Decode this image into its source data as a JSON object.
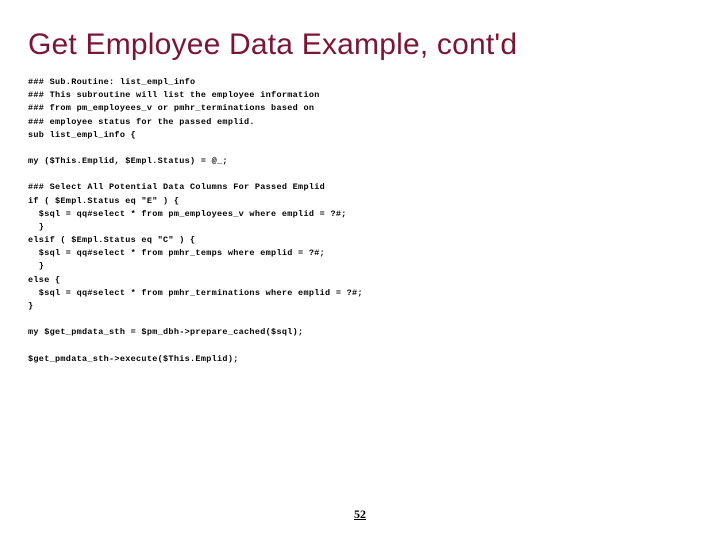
{
  "title": "Get Employee Data Example, cont'd",
  "code_lines": [
    "### Sub.Routine: list_empl_info",
    "### This subroutine will list the employee information",
    "### from pm_employees_v or pmhr_terminations based on",
    "### employee status for the passed emplid.",
    "sub list_empl_info {",
    "",
    "my ($This.Emplid, $Empl.Status) = @_;",
    "",
    "### Select All Potential Data Columns For Passed Emplid",
    "if ( $Empl.Status eq \"E\" ) {",
    "  $sql = qq#select * from pm_employees_v where emplid = ?#;",
    "  }",
    "elsif ( $Empl.Status eq \"C\" ) {",
    "  $sql = qq#select * from pmhr_temps where emplid = ?#;",
    "  }",
    "else {",
    "  $sql = qq#select * from pmhr_terminations where emplid = ?#;",
    "}",
    "",
    "my $get_pmdata_sth = $pm_dbh->prepare_cached($sql);",
    "",
    "$get_pmdata_sth->execute($This.Emplid);"
  ],
  "page_number": "52"
}
